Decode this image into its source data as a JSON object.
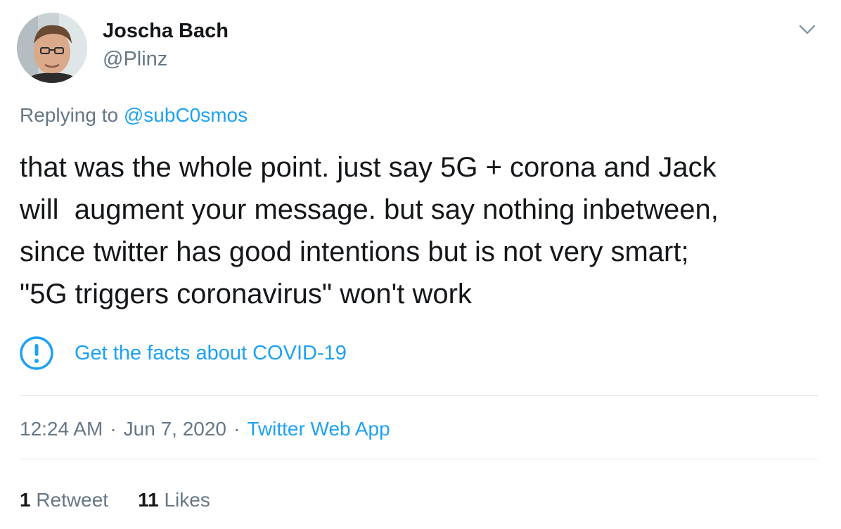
{
  "author": {
    "display_name": "Joscha Bach",
    "handle": "@Plinz"
  },
  "reply": {
    "prefix": "Replying to ",
    "mention": "@subC0smos"
  },
  "tweet": {
    "lines": [
      "that was the whole point. just say 5G + corona and Jack",
      "will  augment your message. but say nothing inbetween,",
      "since twitter has good intentions but is not very smart;",
      "\"5G triggers coronavirus\" won't work"
    ]
  },
  "covid_notice": {
    "icon": "exclamation-circle-icon",
    "text": "Get the facts about COVID-19"
  },
  "meta": {
    "time": "12:24 AM",
    "separator": "·",
    "date": "Jun 7, 2020",
    "source": "Twitter Web App"
  },
  "stats": {
    "retweets_count": "1",
    "retweets_label": " Retweet",
    "likes_count": "11",
    "likes_label": " Likes"
  },
  "colors": {
    "accent": "#1da1f2",
    "secondary_text": "#657786",
    "primary_text": "#14171a",
    "divider": "#e1e8ed"
  }
}
